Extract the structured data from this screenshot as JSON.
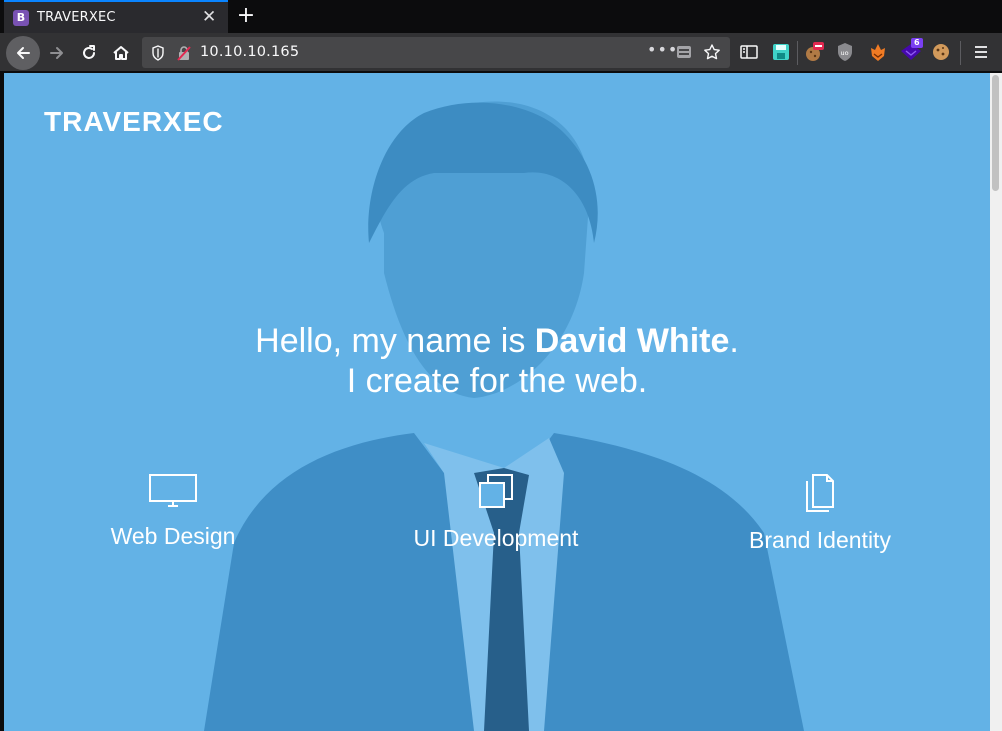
{
  "browser": {
    "tab": {
      "title": "TRAVERXEC",
      "favicon_letter": "B",
      "favicon_color": "#7952b3"
    },
    "url": "10.10.10.165",
    "accent_color": "#0a84ff",
    "extension_badges": {
      "ublock": "uo",
      "counter": "6"
    }
  },
  "page": {
    "brand": "TRAVERXEC",
    "hero": {
      "greeting": "Hello, my name is ",
      "name": "David White",
      "period": ".",
      "tagline": "I create for the web."
    },
    "services": [
      {
        "label": "Web Design",
        "icon": "monitor-icon"
      },
      {
        "label": "UI Development",
        "icon": "stacked-windows-icon"
      },
      {
        "label": "Brand Identity",
        "icon": "documents-icon"
      }
    ],
    "overlay_color": "#63b2e6"
  }
}
